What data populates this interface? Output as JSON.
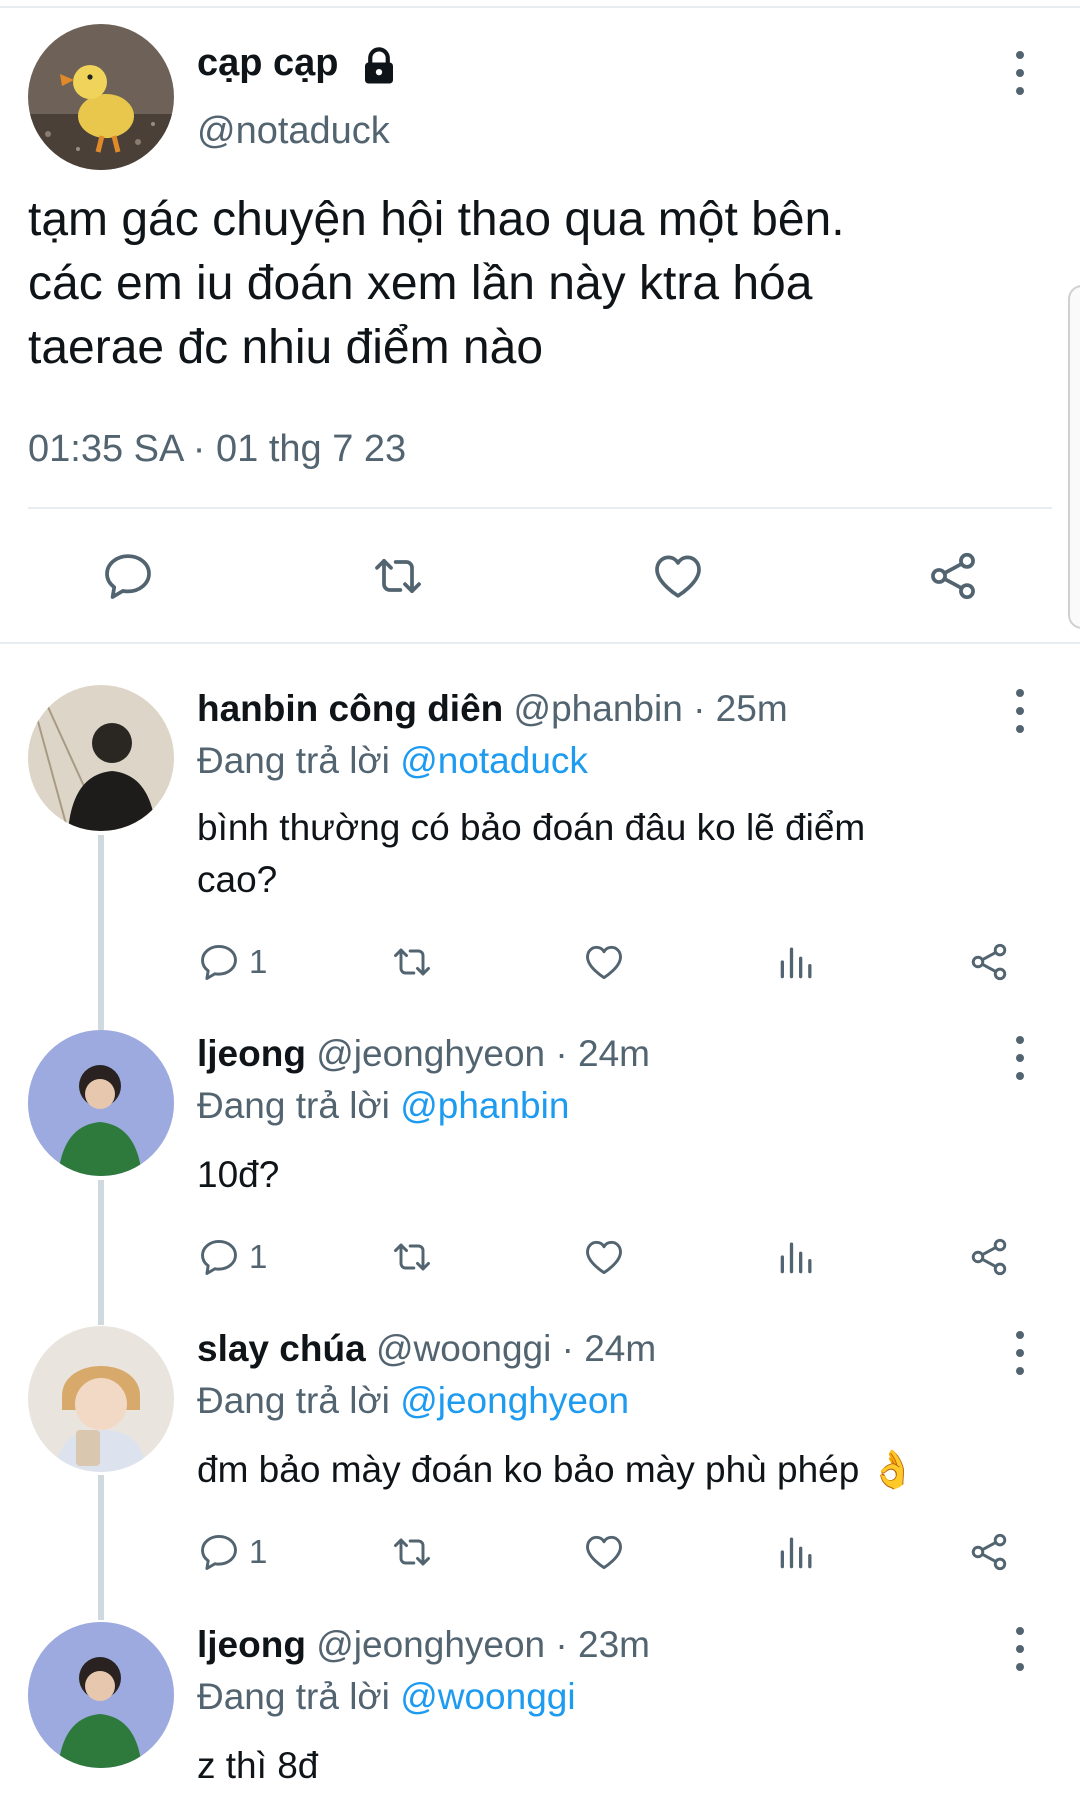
{
  "tweet": {
    "name": "cạp cạp",
    "handle": "@notaduck",
    "text_lines": [
      "tạm gác chuyện hội thao qua một bên.",
      "các em iu đoán xem lần này ktra hóa",
      "taerae đc nhiu điểm nào"
    ],
    "timestamp": "01:35 SA · 01 thg 7 23",
    "icons": [
      "lock-icon",
      "reply-icon",
      "retweet-icon",
      "like-icon",
      "share-icon",
      "more-icon"
    ]
  },
  "replies": [
    {
      "name": "hanbin công diên",
      "meta": "@phanbin · 25m",
      "replying_label": "Đang trả lời",
      "replying_to": "@notaduck",
      "text_lines": [
        "bình thường có bảo đoán đâu ko lẽ điểm",
        "cao?"
      ],
      "reply_count": "1"
    },
    {
      "name": "ljeong",
      "meta": "@jeonghyeon · 24m",
      "replying_label": "Đang trả lời",
      "replying_to": "@phanbin",
      "text_lines": [
        "10đ?"
      ],
      "reply_count": "1"
    },
    {
      "name": "slay chúa",
      "meta": "@woonggi · 24m",
      "replying_label": "Đang trả lời",
      "replying_to": "@jeonghyeon",
      "text_lines": [
        "đm bảo mày đoán ko bảo mày phù phép 👌"
      ],
      "reply_count": "1"
    },
    {
      "name": "ljeong",
      "meta": "@jeonghyeon · 23m",
      "replying_label": "Đang trả lời",
      "replying_to": "@woonggi",
      "text_lines": [
        "z thì 8đ"
      ]
    }
  ],
  "colors": {
    "text": "#0f1419",
    "muted": "#536471",
    "link": "#1d9bf0",
    "divider": "#e6ecf0"
  }
}
